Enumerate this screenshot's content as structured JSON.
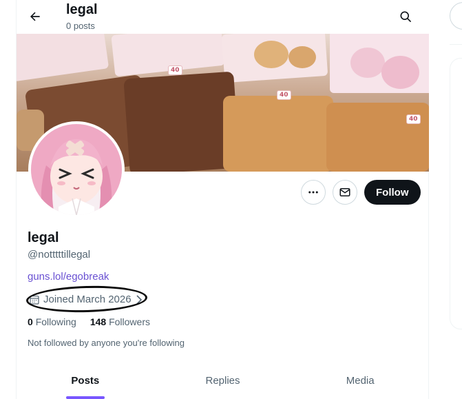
{
  "header": {
    "title": "legal",
    "post_count": "0 posts"
  },
  "profile": {
    "display_name": "legal",
    "handle": "@notttttillegal",
    "link": "guns.lol/egobreak",
    "joined": "Joined March 2026",
    "following_count": "0",
    "following_label": "Following",
    "followers_count": "148",
    "followers_label": "Followers",
    "not_followed_text": "Not followed by anyone you're following"
  },
  "actions": {
    "follow_label": "Follow"
  },
  "tabs": [
    {
      "label": "Posts",
      "active": true
    },
    {
      "label": "Replies",
      "active": false
    },
    {
      "label": "Media",
      "active": false
    }
  ],
  "banner": {
    "tags": [
      "40",
      "40",
      "40"
    ]
  },
  "colors": {
    "accent": "#7856ff",
    "link": "#6950d2",
    "text": "#0f1419",
    "muted": "#536471",
    "annotation_ring": "#0a0a0a"
  },
  "icons": [
    "back-arrow-icon",
    "search-icon",
    "more-icon",
    "mail-icon",
    "calendar-icon",
    "chevron-right-icon"
  ]
}
